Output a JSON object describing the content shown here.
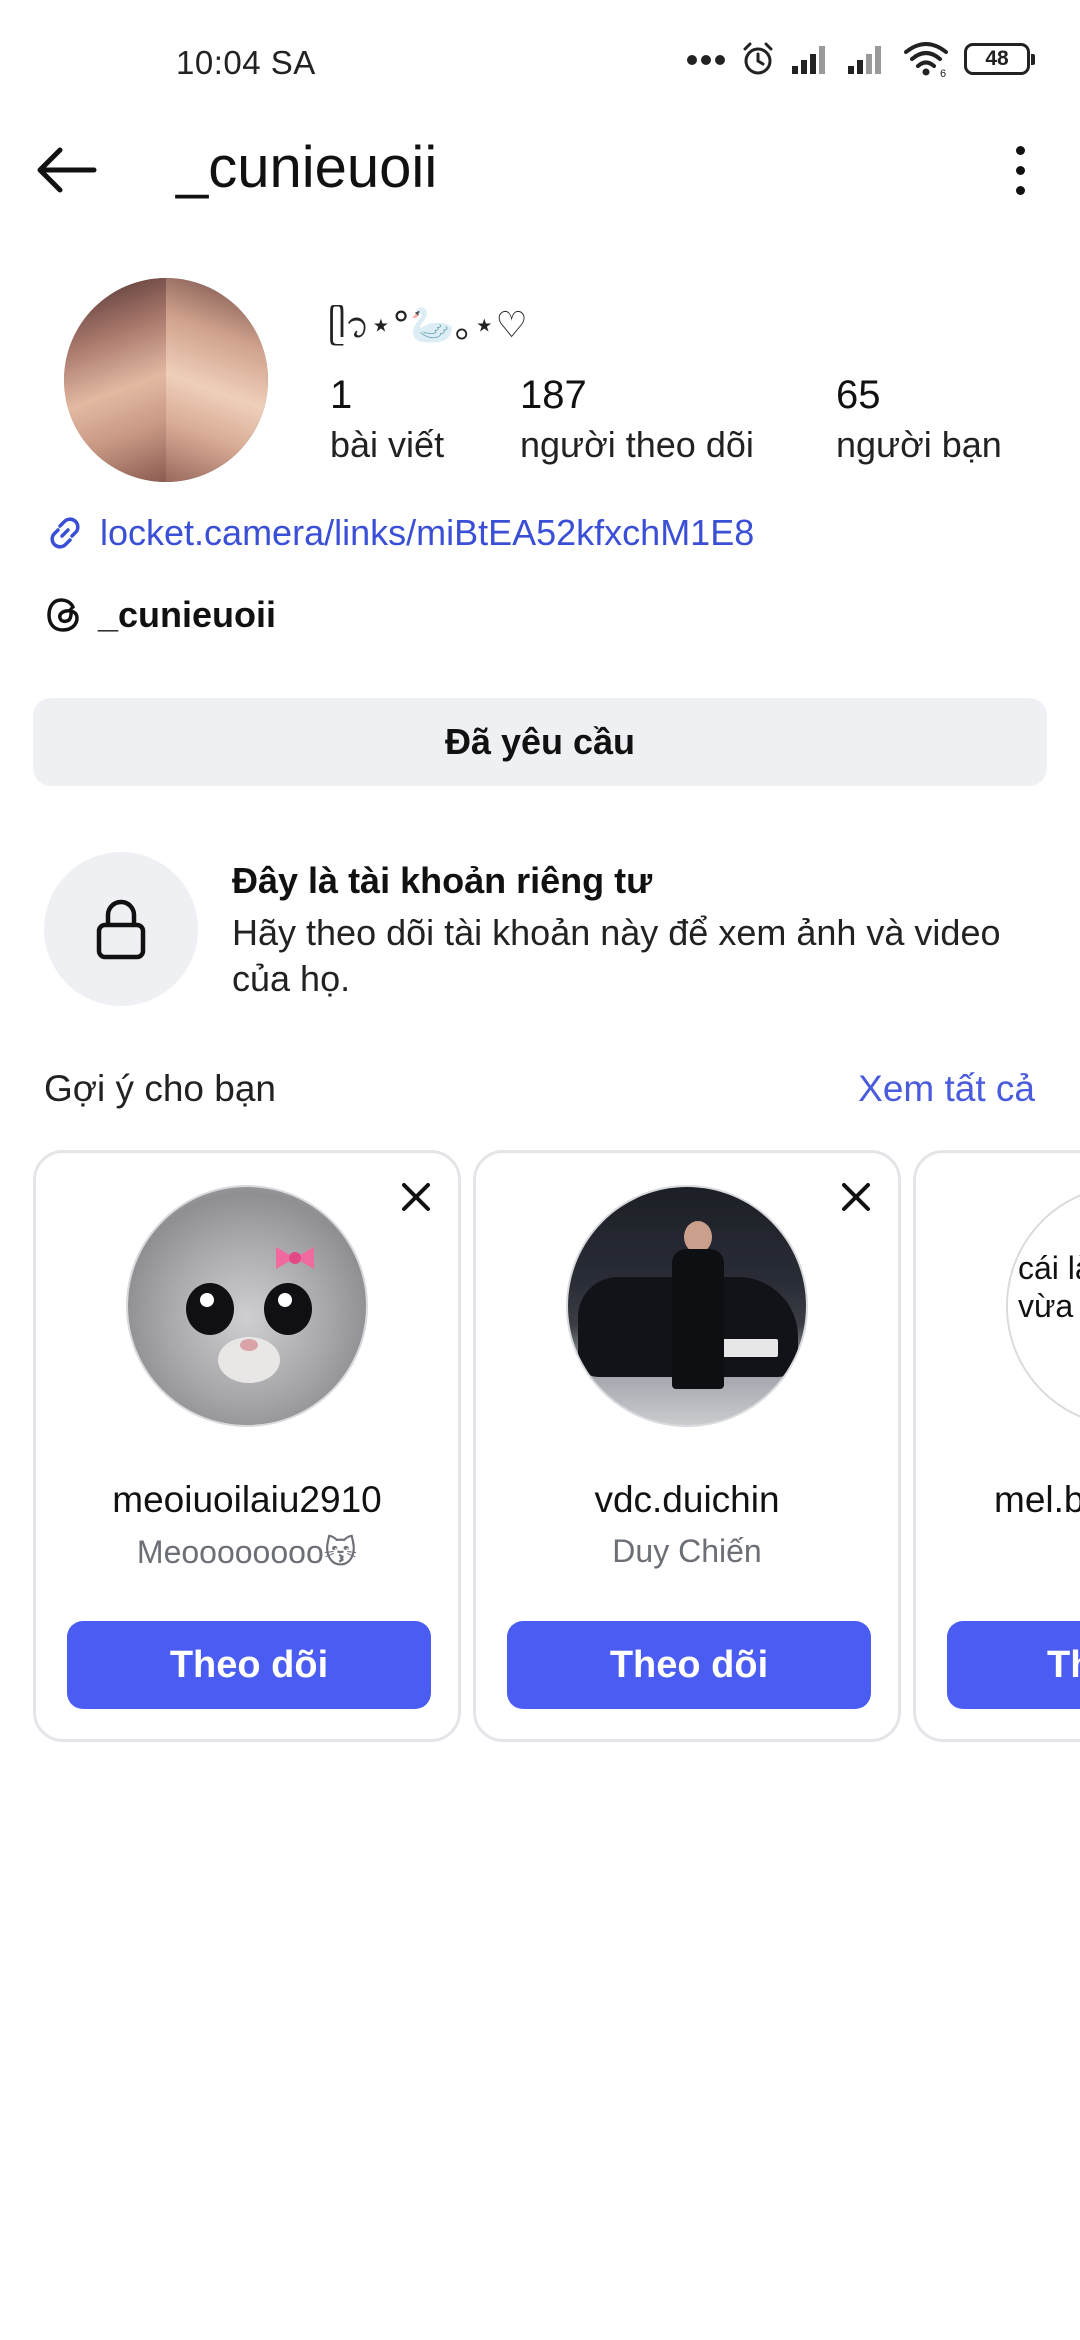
{
  "status_bar": {
    "time": "10:04 SA",
    "battery": "48",
    "network_badge": "6"
  },
  "header": {
    "title": "_cunieuoii"
  },
  "profile": {
    "bio_name": "ᥫ᭡⋆°🦢｡⋆♡",
    "stats": [
      {
        "value": "1",
        "label": "bài viết"
      },
      {
        "value": "187",
        "label": "người theo dõi"
      },
      {
        "value": "65",
        "label": "người bạn"
      }
    ],
    "link": "locket.camera/links/miBtEA52kfxchM1E8",
    "threads_handle": "_cunieuoii",
    "requested_label": "Đã yêu cầu"
  },
  "private_notice": {
    "title": "Đây là tài khoản riêng tư",
    "description": "Hãy theo dõi tài khoản này để xem ảnh và video của họ."
  },
  "suggestions": {
    "title": "Gợi ý cho bạn",
    "see_all": "Xem tất cả",
    "cards": [
      {
        "username": "meoiuoilaiu2910",
        "full_name": "Meoooooooo😽",
        "follow_label": "Theo dõi"
      },
      {
        "username": "vdc.duichin",
        "full_name": "Duy Chiến",
        "follow_label": "Theo dõi"
      },
      {
        "username": "mel.b",
        "full_name": "",
        "follow_label": "Th",
        "avatar_text": "cái làm vừa vừa"
      }
    ]
  },
  "colors": {
    "accent": "#4a5cf1",
    "link": "#3a4fd6",
    "muted_bg": "#eff0f3"
  }
}
